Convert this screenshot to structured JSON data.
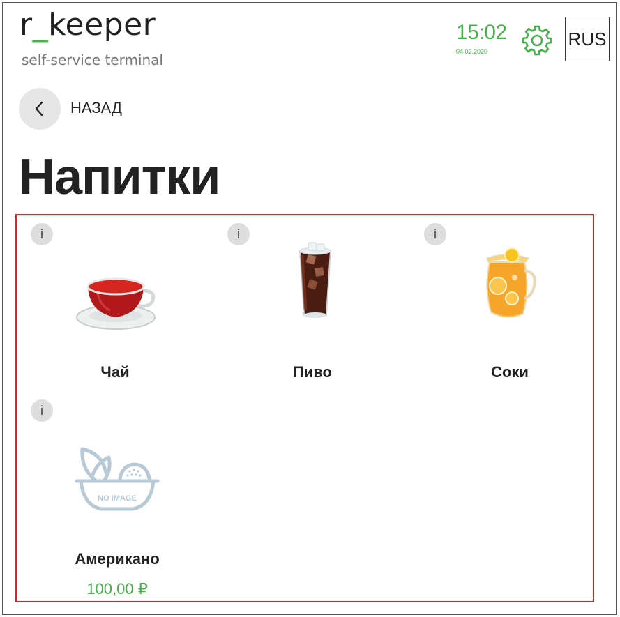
{
  "header": {
    "logo_main": "r",
    "logo_underscore": "_",
    "logo_rest": "keeper",
    "logo_subtitle": "self-service terminal",
    "time": "15:02",
    "date": "04.02.2020",
    "settings_icon": "gear-icon",
    "language": "RUS"
  },
  "nav": {
    "back_icon": "chevron-left-icon",
    "back_label": "НАЗАД"
  },
  "page": {
    "title": "Напитки"
  },
  "products": [
    {
      "name": "Чай",
      "price": "",
      "info": "i",
      "image": "tea-cup-image"
    },
    {
      "name": "Пиво",
      "price": "",
      "info": "i",
      "image": "iced-drink-glass-image"
    },
    {
      "name": "Соки",
      "price": "",
      "info": "i",
      "image": "juice-jug-image"
    },
    {
      "name": "Американо",
      "price": "100,00 ₽",
      "info": "i",
      "image": "no-image-placeholder",
      "placeholder_text": "NO IMAGE"
    }
  ],
  "colors": {
    "accent_green": "#46b24a",
    "highlight_red": "#d7232c",
    "button_gray": "#e5e5e5"
  }
}
